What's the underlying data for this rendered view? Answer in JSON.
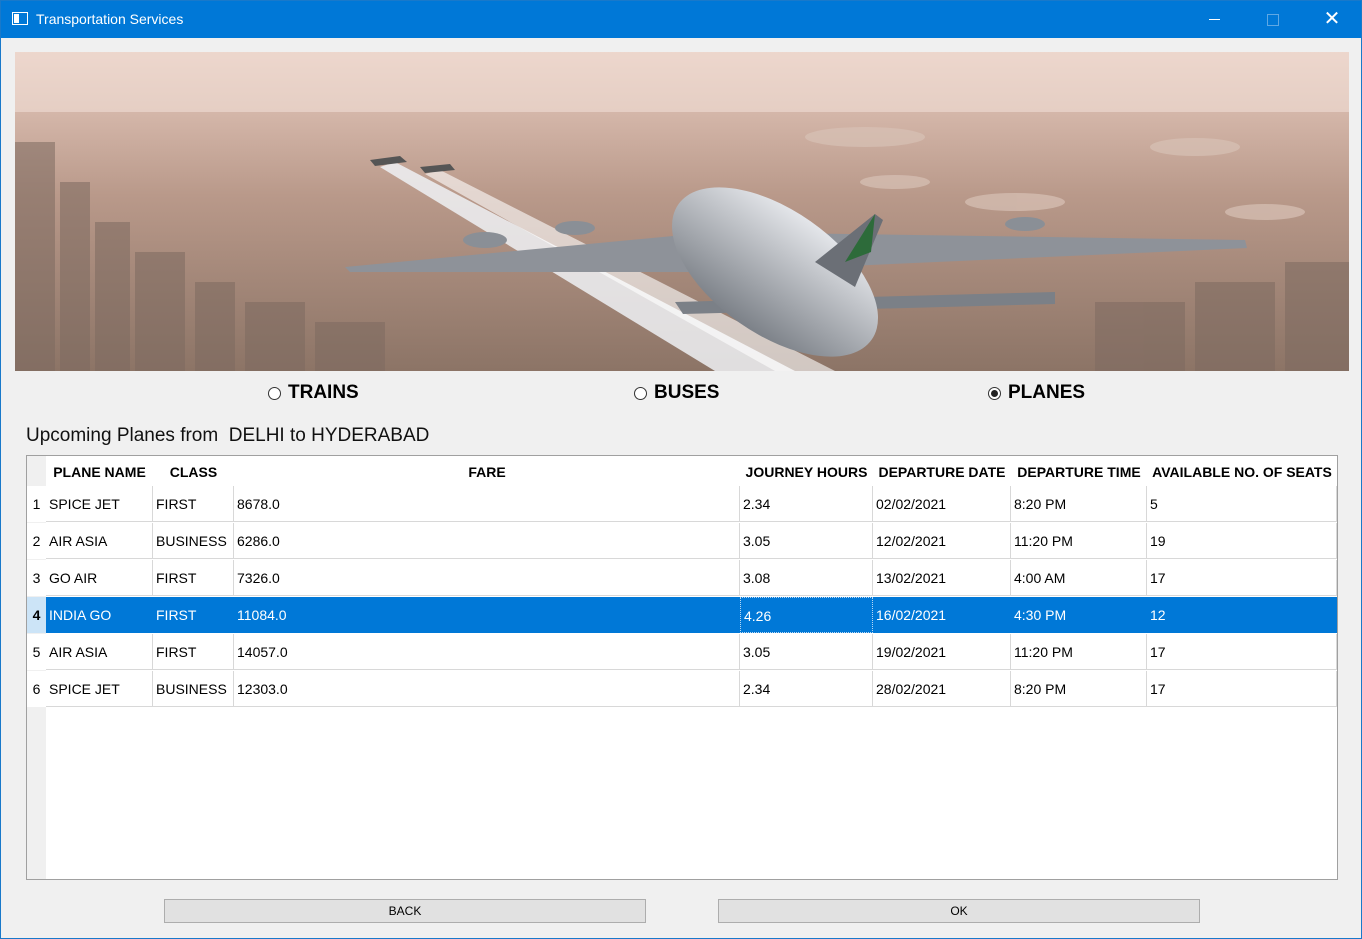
{
  "window": {
    "title": "Transportation Services"
  },
  "modes": [
    {
      "label": "TRAINS",
      "selected": false
    },
    {
      "label": "BUSES",
      "selected": false
    },
    {
      "label": "PLANES",
      "selected": true
    }
  ],
  "heading": "Upcoming Planes from  DELHI to HYDERABAD",
  "table": {
    "columns": [
      "PLANE NAME",
      "CLASS",
      "FARE",
      "JOURNEY HOURS",
      "DEPARTURE DATE",
      "DEPARTURE TIME",
      "AVAILABLE NO. OF SEATS"
    ],
    "rows": [
      {
        "num": "1",
        "cells": [
          "SPICE JET",
          "FIRST",
          "8678.0",
          "2.34",
          "02/02/2021",
          "8:20 PM",
          "5"
        ]
      },
      {
        "num": "2",
        "cells": [
          "AIR ASIA",
          "BUSINESS",
          "6286.0",
          "3.05",
          "12/02/2021",
          "11:20 PM",
          "19"
        ]
      },
      {
        "num": "3",
        "cells": [
          "GO AIR",
          "FIRST",
          "7326.0",
          "3.08",
          "13/02/2021",
          "4:00 AM",
          "17"
        ]
      },
      {
        "num": "4",
        "cells": [
          "INDIA GO",
          "FIRST",
          "11084.0",
          "4.26",
          "16/02/2021",
          "4:30 PM",
          "12"
        ]
      },
      {
        "num": "5",
        "cells": [
          "AIR ASIA",
          "FIRST",
          "14057.0",
          "3.05",
          "19/02/2021",
          "11:20 PM",
          "17"
        ]
      },
      {
        "num": "6",
        "cells": [
          "SPICE JET",
          "BUSINESS",
          "12303.0",
          "2.34",
          "28/02/2021",
          "8:20 PM",
          "17"
        ]
      }
    ],
    "selected_row": 4
  },
  "buttons": {
    "back": "BACK",
    "ok": "OK"
  },
  "colors": {
    "titlebar": "#0078d7",
    "selection": "#0078d7"
  }
}
